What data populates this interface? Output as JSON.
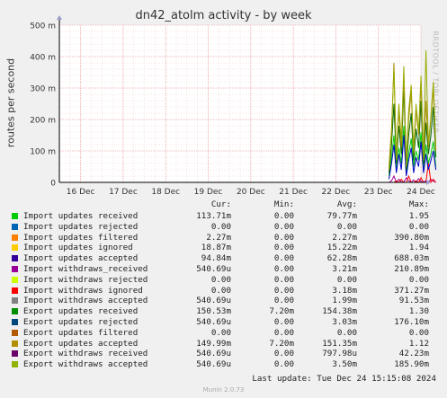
{
  "chart_data": {
    "type": "line",
    "title": "dn42_atolm activity - by week",
    "ylabel": "routes per second",
    "ylim": [
      0,
      500
    ],
    "yticks": [
      {
        "v": 0,
        "l": "0"
      },
      {
        "v": 100,
        "l": "100 m"
      },
      {
        "v": 200,
        "l": "200 m"
      },
      {
        "v": 300,
        "l": "300 m"
      },
      {
        "v": 400,
        "l": "400 m"
      },
      {
        "v": 500,
        "l": "500 m"
      }
    ],
    "xticks": [
      "16 Dec",
      "17 Dec",
      "18 Dec",
      "19 Dec",
      "20 Dec",
      "21 Dec",
      "22 Dec",
      "23 Dec",
      "24 Dec"
    ],
    "grid": true,
    "data_start_day": 7.25,
    "data_end_day": 8.35,
    "series": [
      {
        "name": "Import updates received",
        "color": "#00cc00",
        "values": [
          20,
          80,
          150,
          40,
          110,
          60,
          180,
          30,
          90,
          140,
          50,
          100,
          70,
          160,
          40,
          120,
          60,
          90,
          130,
          50
        ]
      },
      {
        "name": "Import withdraws_received",
        "color": "#990099",
        "values": [
          0,
          5,
          20,
          0,
          10,
          2,
          0,
          15,
          5,
          0,
          8,
          0,
          12,
          3,
          0,
          6,
          0,
          10,
          4,
          0
        ]
      },
      {
        "name": "Import withdraws ignored",
        "color": "#ff0000",
        "values": [
          0,
          0,
          0,
          5,
          0,
          10,
          0,
          0,
          20,
          0,
          0,
          5,
          0,
          15,
          0,
          0,
          60,
          0,
          10,
          0
        ]
      },
      {
        "name": "Import updates accepted",
        "color": "#0000cc",
        "values": [
          10,
          60,
          120,
          30,
          90,
          40,
          150,
          20,
          70,
          110,
          30,
          80,
          50,
          130,
          30,
          90,
          40,
          70,
          100,
          40
        ]
      },
      {
        "name": "Export updates received",
        "color": "#006600",
        "values": [
          30,
          120,
          250,
          60,
          180,
          90,
          300,
          40,
          150,
          220,
          70,
          170,
          110,
          260,
          60,
          190,
          90,
          150,
          240,
          80
        ]
      },
      {
        "name": "Export updates accepted",
        "color": "#aa8800",
        "values": [
          40,
          150,
          380,
          70,
          230,
          110,
          340,
          50,
          200,
          290,
          90,
          230,
          150,
          320,
          70,
          260,
          110,
          200,
          300,
          100
        ]
      },
      {
        "name": "Export withdraws accepted",
        "color": "#99aa00",
        "values": [
          50,
          170,
          360,
          80,
          250,
          130,
          370,
          60,
          230,
          310,
          100,
          250,
          160,
          340,
          80,
          420,
          120,
          210,
          320,
          110
        ]
      }
    ],
    "legend": {
      "headers": [
        "Cur:",
        "Min:",
        "Avg:",
        "Max:"
      ],
      "rows": [
        {
          "name": "Import updates received",
          "color": "#00cc00",
          "cur": "113.71m",
          "min": "0.00",
          "avg": "79.77m",
          "max": "1.95"
        },
        {
          "name": "Import updates rejected",
          "color": "#0066b3",
          "cur": "0.00",
          "min": "0.00",
          "avg": "0.00",
          "max": "0.00"
        },
        {
          "name": "Import updates filtered",
          "color": "#ff8000",
          "cur": "2.27m",
          "min": "0.00",
          "avg": "2.27m",
          "max": "390.80m"
        },
        {
          "name": "Import updates ignored",
          "color": "#ffcc00",
          "cur": "18.87m",
          "min": "0.00",
          "avg": "15.22m",
          "max": "1.94"
        },
        {
          "name": "Import updates accepted",
          "color": "#330099",
          "cur": "94.84m",
          "min": "0.00",
          "avg": "62.28m",
          "max": "688.03m"
        },
        {
          "name": "Import withdraws_received",
          "color": "#990099",
          "cur": "540.69u",
          "min": "0.00",
          "avg": "3.21m",
          "max": "210.89m"
        },
        {
          "name": "Import withdraws rejected",
          "color": "#ccff00",
          "cur": "0.00",
          "min": "0.00",
          "avg": "0.00",
          "max": "0.00"
        },
        {
          "name": "Import withdraws ignored",
          "color": "#ff0000",
          "cur": "0.00",
          "min": "0.00",
          "avg": "3.18m",
          "max": "371.27m"
        },
        {
          "name": "Import withdraws accepted",
          "color": "#808080",
          "cur": "540.69u",
          "min": "0.00",
          "avg": "1.99m",
          "max": "91.53m"
        },
        {
          "name": "Export updates received",
          "color": "#008f00",
          "cur": "150.53m",
          "min": "7.20m",
          "avg": "154.38m",
          "max": "1.30"
        },
        {
          "name": "Export updates rejected",
          "color": "#00487d",
          "cur": "540.69u",
          "min": "0.00",
          "avg": "3.03m",
          "max": "176.10m"
        },
        {
          "name": "Export updates filtered",
          "color": "#b35a00",
          "cur": "0.00",
          "min": "0.00",
          "avg": "0.00",
          "max": "0.00"
        },
        {
          "name": "Export updates accepted",
          "color": "#b38f00",
          "cur": "149.99m",
          "min": "7.20m",
          "avg": "151.35m",
          "max": "1.12"
        },
        {
          "name": "Export withdraws received",
          "color": "#6b006b",
          "cur": "540.69u",
          "min": "0.00",
          "avg": "797.98u",
          "max": "42.23m"
        },
        {
          "name": "Export withdraws accepted",
          "color": "#8fb300",
          "cur": "540.69u",
          "min": "0.00",
          "avg": "3.50m",
          "max": "185.90m"
        }
      ]
    }
  },
  "side_text": "RRDTOOL / TOBI OETIKER",
  "last_update": "Last update: Tue Dec 24 15:15:08 2024",
  "version": "Munin 2.0.73"
}
